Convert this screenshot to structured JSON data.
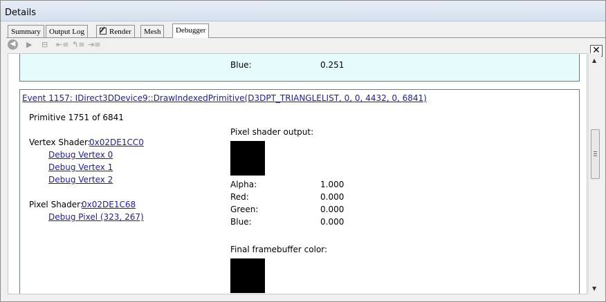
{
  "window": {
    "title": "Details"
  },
  "tabs": [
    {
      "label": "Summary"
    },
    {
      "label": "Output Log"
    },
    {
      "label": "Render"
    },
    {
      "label": "Mesh"
    },
    {
      "label": "Debugger"
    }
  ],
  "active_tab": "Debugger",
  "close_label": "✕",
  "previous_panel": {
    "blue_label": "Blue:",
    "blue_value": "0.251",
    "background_color": "#e6fbfc"
  },
  "event": {
    "title": "Event 1157: IDirect3DDevice9::DrawIndexedPrimitive(D3DPT_TRIANGLELIST, 0, 0, 4432, 0, 6841)",
    "primitive_text": "Primitive 1751 of 6841",
    "vertex_shader_label": "Vertex Shader:",
    "vertex_shader_addr": "0x02DE1CC0",
    "debug_vertices": [
      "Debug Vertex 0",
      "Debug Vertex 1",
      "Debug Vertex 2"
    ],
    "pixel_shader_label": "Pixel Shader:",
    "pixel_shader_addr": "0x02DE1C68",
    "debug_pixel": "Debug Pixel (323, 267)",
    "pixel_output": {
      "heading": "Pixel shader output:",
      "swatch_color": "#000000",
      "alpha_label": "Alpha:",
      "alpha_value": "1.000",
      "red_label": "Red:",
      "red_value": "0.000",
      "green_label": "Green:",
      "green_value": "0.000",
      "blue_label": "Blue:",
      "blue_value": "0.000"
    },
    "final_framebuffer": {
      "heading": "Final framebuffer color:",
      "swatch_color": "#000000"
    }
  },
  "colors": {
    "link": "#1a1ab0",
    "panel_border": "#6a7b86"
  }
}
